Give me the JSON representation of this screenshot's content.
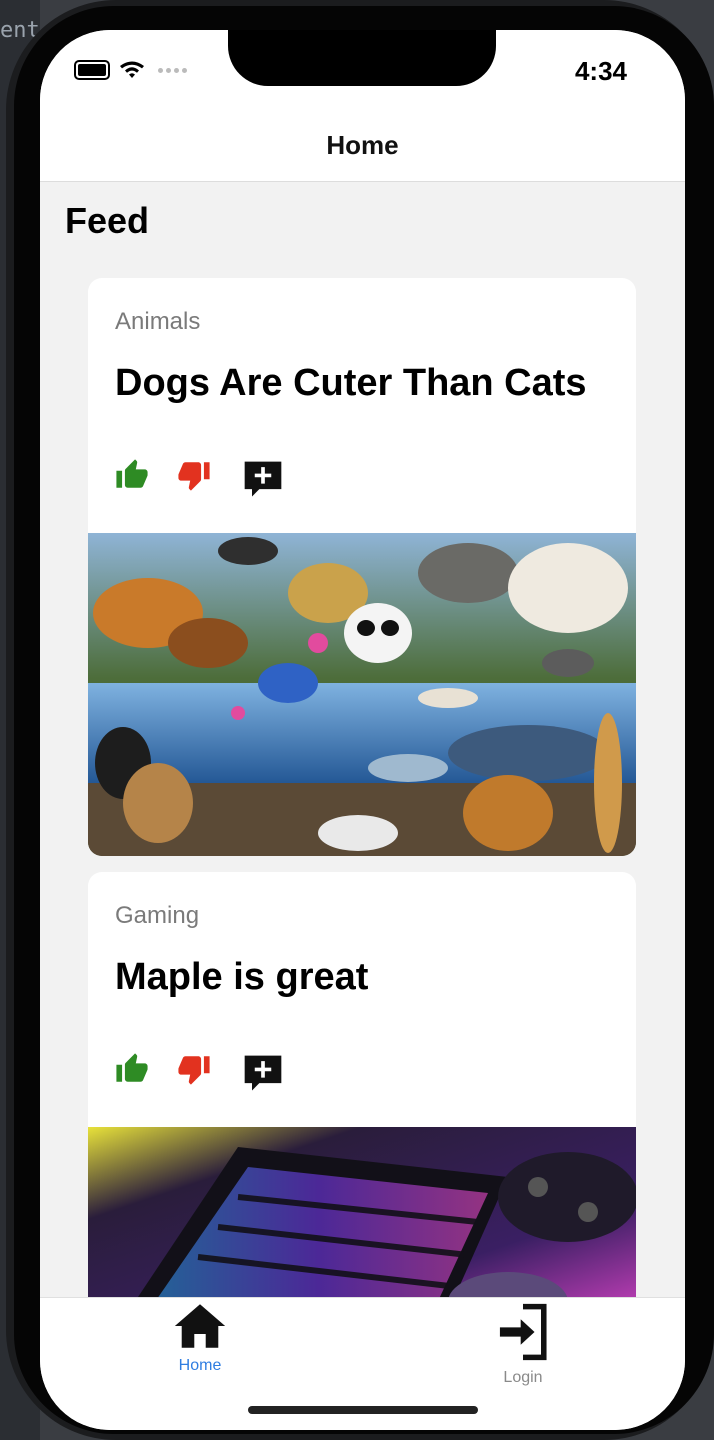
{
  "statusbar": {
    "time": "4:34"
  },
  "nav": {
    "title": "Home"
  },
  "feed": {
    "title": "Feed",
    "posts": [
      {
        "category": "Animals",
        "title": "Dogs Are Cuter Than Cats",
        "image": "wild-animals-collage"
      },
      {
        "category": "Gaming",
        "title": "Maple is great",
        "image": "rgb-keyboard-and-controller"
      }
    ]
  },
  "actions": {
    "like_icon": "thumbs-up-icon",
    "dislike_icon": "thumbs-down-icon",
    "comment_icon": "add-comment-icon"
  },
  "tabs": [
    {
      "label": "Home",
      "icon": "home-icon",
      "active": true
    },
    {
      "label": "Login",
      "icon": "login-icon",
      "active": false
    }
  ],
  "colors": {
    "like": "#2e8b24",
    "dislike": "#e2321f",
    "active_tab": "#2f7de1",
    "inactive_tab": "#8a8a8a"
  }
}
